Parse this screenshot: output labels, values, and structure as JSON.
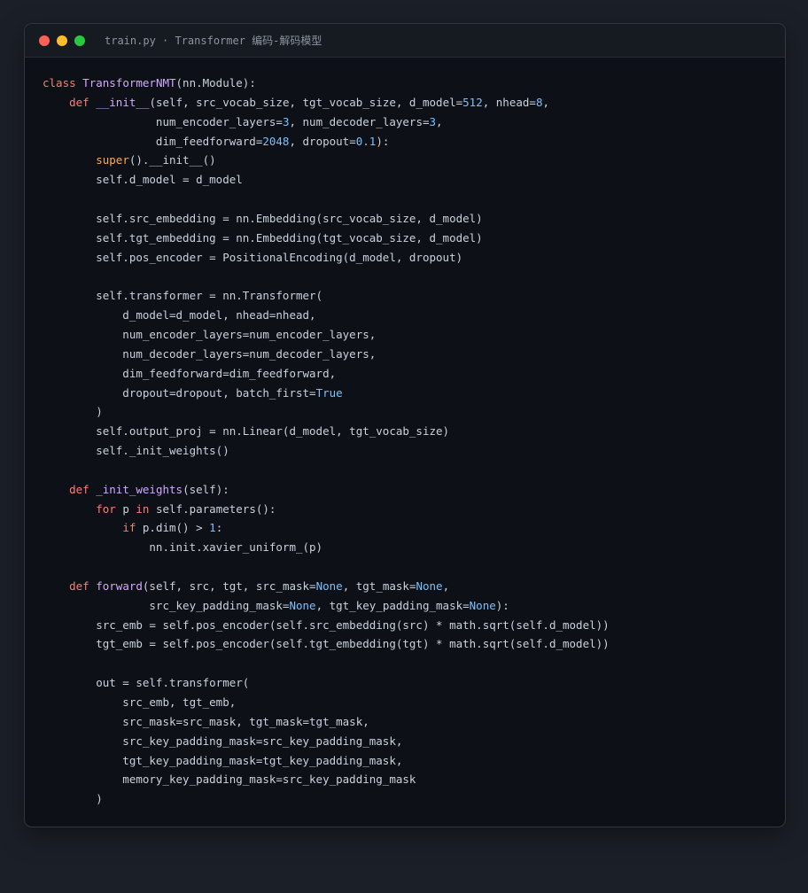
{
  "window": {
    "title": "train.py · Transformer 编码-解码模型",
    "controls": [
      "close",
      "minimize",
      "maximize"
    ]
  },
  "colors": {
    "keyword": "#ff7b72",
    "function": "#d2a8ff",
    "number": "#79c0ff",
    "builtin": "#ffa657",
    "constant": "#79c0ff",
    "text": "#c9d1d9",
    "editor_bg": "#0d1117"
  },
  "code_lines": [
    [
      [
        "kw",
        "class"
      ],
      [
        "tx",
        " "
      ],
      [
        "cls",
        "TransformerNMT"
      ],
      [
        "tx",
        "(nn.Module):"
      ]
    ],
    [
      [
        "tx",
        "    "
      ],
      [
        "kw",
        "def"
      ],
      [
        "tx",
        " "
      ],
      [
        "fn",
        "__init__"
      ],
      [
        "tx",
        "(self, src_vocab_size, tgt_vocab_size, d_model="
      ],
      [
        "num",
        "512"
      ],
      [
        "tx",
        ", nhead="
      ],
      [
        "num",
        "8"
      ],
      [
        "tx",
        ","
      ]
    ],
    [
      [
        "tx",
        "                 num_encoder_layers="
      ],
      [
        "num",
        "3"
      ],
      [
        "tx",
        ", num_decoder_layers="
      ],
      [
        "num",
        "3"
      ],
      [
        "tx",
        ","
      ]
    ],
    [
      [
        "tx",
        "                 dim_feedforward="
      ],
      [
        "num",
        "2048"
      ],
      [
        "tx",
        ", dropout="
      ],
      [
        "num",
        "0.1"
      ],
      [
        "tx",
        "):"
      ]
    ],
    [
      [
        "tx",
        "        "
      ],
      [
        "bi",
        "super"
      ],
      [
        "tx",
        "().__init__()"
      ]
    ],
    [
      [
        "tx",
        "        self.d_model = d_model"
      ]
    ],
    [
      [
        "tx",
        ""
      ]
    ],
    [
      [
        "tx",
        "        self.src_embedding = nn.Embedding(src_vocab_size, d_model)"
      ]
    ],
    [
      [
        "tx",
        "        self.tgt_embedding = nn.Embedding(tgt_vocab_size, d_model)"
      ]
    ],
    [
      [
        "tx",
        "        self.pos_encoder = PositionalEncoding(d_model, dropout)"
      ]
    ],
    [
      [
        "tx",
        ""
      ]
    ],
    [
      [
        "tx",
        "        self.transformer = nn.Transformer("
      ]
    ],
    [
      [
        "tx",
        "            d_model=d_model, nhead=nhead,"
      ]
    ],
    [
      [
        "tx",
        "            num_encoder_layers=num_encoder_layers,"
      ]
    ],
    [
      [
        "tx",
        "            num_decoder_layers=num_decoder_layers,"
      ]
    ],
    [
      [
        "tx",
        "            dim_feedforward=dim_feedforward,"
      ]
    ],
    [
      [
        "tx",
        "            dropout=dropout, batch_first="
      ],
      [
        "cst",
        "True"
      ]
    ],
    [
      [
        "tx",
        "        )"
      ]
    ],
    [
      [
        "tx",
        "        self.output_proj = nn.Linear(d_model, tgt_vocab_size)"
      ]
    ],
    [
      [
        "tx",
        "        self._init_weights()"
      ]
    ],
    [
      [
        "tx",
        ""
      ]
    ],
    [
      [
        "tx",
        "    "
      ],
      [
        "kw",
        "def"
      ],
      [
        "tx",
        " "
      ],
      [
        "fn",
        "_init_weights"
      ],
      [
        "tx",
        "(self):"
      ]
    ],
    [
      [
        "tx",
        "        "
      ],
      [
        "kw",
        "for"
      ],
      [
        "tx",
        " p "
      ],
      [
        "kw",
        "in"
      ],
      [
        "tx",
        " self.parameters():"
      ]
    ],
    [
      [
        "tx",
        "            "
      ],
      [
        "kw",
        "if"
      ],
      [
        "tx",
        " p.dim() > "
      ],
      [
        "num",
        "1"
      ],
      [
        "tx",
        ":"
      ]
    ],
    [
      [
        "tx",
        "                nn.init.xavier_uniform_(p)"
      ]
    ],
    [
      [
        "tx",
        ""
      ]
    ],
    [
      [
        "tx",
        "    "
      ],
      [
        "kw",
        "def"
      ],
      [
        "tx",
        " "
      ],
      [
        "fn",
        "forward"
      ],
      [
        "tx",
        "(self, src, tgt, src_mask="
      ],
      [
        "cst",
        "None"
      ],
      [
        "tx",
        ", tgt_mask="
      ],
      [
        "cst",
        "None"
      ],
      [
        "tx",
        ","
      ]
    ],
    [
      [
        "tx",
        "                src_key_padding_mask="
      ],
      [
        "cst",
        "None"
      ],
      [
        "tx",
        ", tgt_key_padding_mask="
      ],
      [
        "cst",
        "None"
      ],
      [
        "tx",
        "):"
      ]
    ],
    [
      [
        "tx",
        "        src_emb = self.pos_encoder(self.src_embedding(src) * math.sqrt(self.d_model))"
      ]
    ],
    [
      [
        "tx",
        "        tgt_emb = self.pos_encoder(self.tgt_embedding(tgt) * math.sqrt(self.d_model))"
      ]
    ],
    [
      [
        "tx",
        ""
      ]
    ],
    [
      [
        "tx",
        "        out = self.transformer("
      ]
    ],
    [
      [
        "tx",
        "            src_emb, tgt_emb,"
      ]
    ],
    [
      [
        "tx",
        "            src_mask=src_mask, tgt_mask=tgt_mask,"
      ]
    ],
    [
      [
        "tx",
        "            src_key_padding_mask=src_key_padding_mask,"
      ]
    ],
    [
      [
        "tx",
        "            tgt_key_padding_mask=tgt_key_padding_mask,"
      ]
    ],
    [
      [
        "tx",
        "            memory_key_padding_mask=src_key_padding_mask"
      ]
    ],
    [
      [
        "tx",
        "        )"
      ]
    ]
  ]
}
